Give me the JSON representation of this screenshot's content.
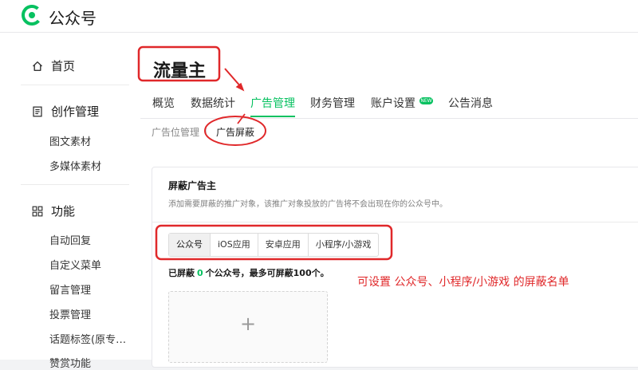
{
  "app": {
    "logo_text": "公众号",
    "accent": "#07c160",
    "annotation_color": "#e0282a"
  },
  "sidebar": {
    "home": "首页",
    "creation": {
      "label": "创作管理",
      "items": [
        "图文素材",
        "多媒体素材"
      ]
    },
    "features": {
      "label": "功能",
      "items": [
        "自动回复",
        "自定义菜单",
        "留言管理",
        "投票管理",
        "话题标签(原专…"
      ]
    },
    "partial_item": "赞赏功能"
  },
  "main": {
    "title": "流量主",
    "tabs": [
      "概览",
      "数据统计",
      "广告管理",
      "财务管理",
      "账户设置",
      "公告消息"
    ],
    "active_tab": "广告管理",
    "new_badge": "NEW",
    "subtabs": [
      "广告位管理",
      "广告屏蔽"
    ],
    "active_subtab": "广告屏蔽",
    "card": {
      "title": "屏蔽广告主",
      "description": "添加需要屏蔽的推广对象，该推广对象投放的广告将不会出现在你的公众号中。",
      "segments": [
        "公众号",
        "iOS应用",
        "安卓应用",
        "小程序/小游戏"
      ],
      "active_segment": "公众号",
      "blocked_prefix": "已屏蔽",
      "blocked_count": "0",
      "blocked_suffix": "个公众号，最多可屏蔽100个。",
      "add_symbol": "+"
    }
  },
  "annotation": {
    "text": "可设置 公众号、小程序/小游戏 的屏蔽名单"
  }
}
